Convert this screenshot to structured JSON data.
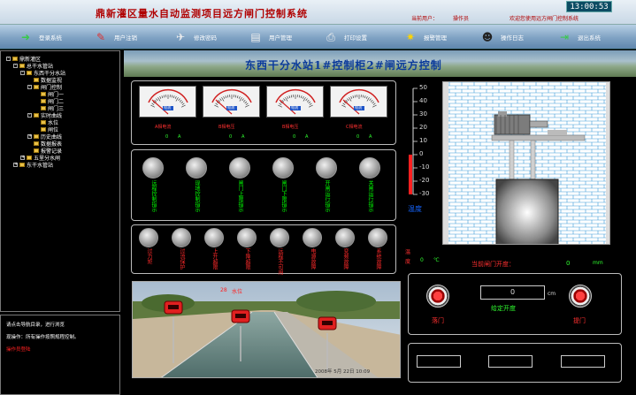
{
  "app": {
    "title": "鼎新灌区量水自动监测项目远方闸门控制系统",
    "current_user_label": "当前用户：",
    "current_user": "操作员",
    "welcome": "欢迎您使用远方闸门控制系统",
    "clock": "13:00:53"
  },
  "toolbar": [
    {
      "label": "登录系统",
      "icon": "login-icon",
      "glyph": "➜"
    },
    {
      "label": "用户注销",
      "icon": "logout-tools-icon",
      "glyph": "✎"
    },
    {
      "label": "修改密码",
      "icon": "password-icon",
      "glyph": "✈"
    },
    {
      "label": "用户管理",
      "icon": "user-manage-icon",
      "glyph": "▤"
    },
    {
      "label": "打印设置",
      "icon": "printer-icon",
      "glyph": "⎙"
    },
    {
      "label": "报警管理",
      "icon": "alarm-icon",
      "glyph": "✷"
    },
    {
      "label": "操作日志",
      "icon": "log-icon",
      "glyph": "☻"
    },
    {
      "label": "退出系统",
      "icon": "exit-icon",
      "glyph": "⇥"
    }
  ],
  "tree": [
    {
      "label": "鼎新灌区",
      "level": 0,
      "toggle": "-"
    },
    {
      "label": "总干水管站",
      "level": 1,
      "toggle": "-"
    },
    {
      "label": "东西干分水站",
      "level": 2,
      "toggle": "-"
    },
    {
      "label": "数据监视",
      "level": 3,
      "toggle": ""
    },
    {
      "label": "闸门控制",
      "level": 3,
      "toggle": "-"
    },
    {
      "label": "闸门一",
      "level": 4,
      "toggle": ""
    },
    {
      "label": "闸门二",
      "level": 4,
      "toggle": ""
    },
    {
      "label": "闸门三",
      "level": 4,
      "toggle": ""
    },
    {
      "label": "实时曲线",
      "level": 3,
      "toggle": "-"
    },
    {
      "label": "水位",
      "level": 4,
      "toggle": ""
    },
    {
      "label": "闸位",
      "level": 4,
      "toggle": ""
    },
    {
      "label": "历史曲线",
      "level": 3,
      "toggle": "+"
    },
    {
      "label": "数据报表",
      "level": 3,
      "toggle": ""
    },
    {
      "label": "报警记录",
      "level": 3,
      "toggle": ""
    },
    {
      "label": "五里分水闸",
      "level": 2,
      "toggle": "+"
    },
    {
      "label": "东干水管站",
      "level": 1,
      "toggle": "+"
    }
  ],
  "info": {
    "line1": "请点击导航目录，进行浏览",
    "line2": "现操作：所有操作按照规程控制。",
    "line3": "操作员登陆"
  },
  "main": {
    "title": "东西干分水站1#控制柜2#闸远方控制"
  },
  "gauges": [
    {
      "label": "A相电流",
      "value": "0",
      "unit": "A"
    },
    {
      "label": "B相电压",
      "value": "0",
      "unit": "A"
    },
    {
      "label": "B相电压",
      "value": "0",
      "unit": "A"
    },
    {
      "label": "C相电流",
      "value": "0",
      "unit": "A"
    }
  ],
  "gauge_face_label": "电流",
  "indicators_top": [
    {
      "label": "远程控制指示"
    },
    {
      "label": "现地控制指示"
    },
    {
      "label": "闸门上限指示"
    },
    {
      "label": "闸门下限指示"
    },
    {
      "label": "开闸运行指示"
    },
    {
      "label": "关闸运行指示"
    }
  ],
  "indicators_bottom": [
    {
      "label": "过力矩"
    },
    {
      "label": "过流保护"
    },
    {
      "label": "上升超限"
    },
    {
      "label": "下降超限"
    },
    {
      "label": "远程不可用"
    },
    {
      "label": "电源故障"
    },
    {
      "label": "变频故障"
    },
    {
      "label": "系统故障"
    }
  ],
  "thermometer": {
    "scale": [
      "50",
      "40",
      "30",
      "20",
      "10",
      "0",
      "-10",
      "-20",
      "-30"
    ],
    "label": "温度",
    "reading_label": "温",
    "reading_label2": "度",
    "reading": "0",
    "unit": "℃",
    "value": 0
  },
  "gate": {
    "opening_label": "当前闸门开度：",
    "opening_value": "0",
    "opening_unit": "mm",
    "open_label": "落门",
    "close_label": "提门",
    "setpoint_value": "0",
    "setpoint_unit": "cm",
    "setpoint_label": "给定开度"
  },
  "camera": {
    "water_level_value": "28",
    "water_level_label": "水位",
    "timestamp": "2008年 5月 22日  10:09"
  },
  "colors": {
    "title_red": "#b00000",
    "indicator_green": "#00ff00",
    "indicator_red": "#ff2a2a",
    "gauge_label_red": "#ff3030"
  }
}
